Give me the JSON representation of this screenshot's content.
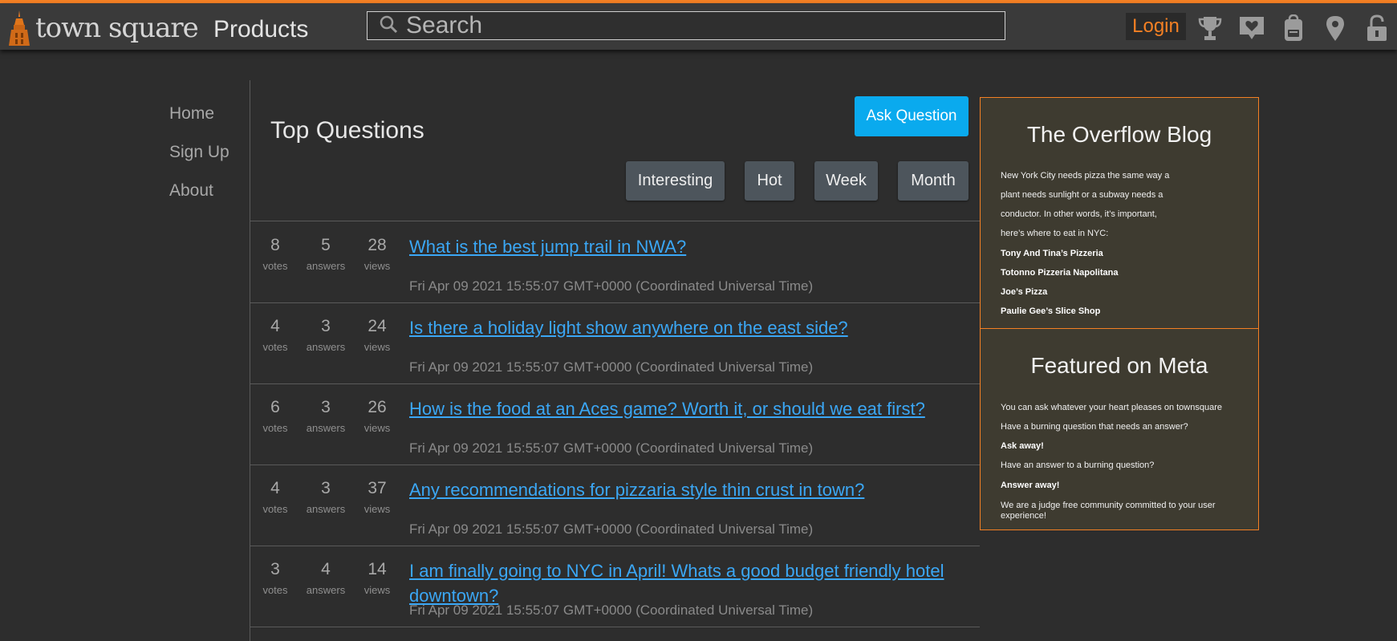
{
  "header": {
    "logo_text_1": "town",
    "logo_text_2": "square",
    "products_label": "Products",
    "search_placeholder": "Search",
    "login_label": "Login",
    "icons": [
      "trophy-icon",
      "heart-tag-icon",
      "backpack-icon",
      "location-pin-icon",
      "unlock-icon"
    ],
    "accent_color": "#f48024"
  },
  "sidebar": {
    "items": [
      {
        "label": "Home"
      },
      {
        "label": "Sign Up"
      },
      {
        "label": "About"
      }
    ]
  },
  "main": {
    "title": "Top Questions",
    "ask_button": "Ask Question",
    "filters": [
      "Interesting",
      "Hot",
      "Week",
      "Month"
    ],
    "stat_labels": {
      "votes": "votes",
      "answers": "answers",
      "views": "views"
    },
    "questions": [
      {
        "votes": "8",
        "answers": "5",
        "views": "28",
        "title": "What is the best jump trail in NWA?",
        "date": "Fri Apr 09 2021 15:55:07 GMT+0000 (Coordinated Universal Time)"
      },
      {
        "votes": "4",
        "answers": "3",
        "views": "24",
        "title": "Is there a holiday light show anywhere on the east side?",
        "date": "Fri Apr 09 2021 15:55:07 GMT+0000 (Coordinated Universal Time)"
      },
      {
        "votes": "6",
        "answers": "3",
        "views": "26",
        "title": "How is the food at an Aces game? Worth it, or should we eat first?",
        "date": "Fri Apr 09 2021 15:55:07 GMT+0000 (Coordinated Universal Time)"
      },
      {
        "votes": "4",
        "answers": "3",
        "views": "37",
        "title": "Any recommendations for pizzaria style thin crust in town?",
        "date": "Fri Apr 09 2021 15:55:07 GMT+0000 (Coordinated Universal Time)"
      },
      {
        "votes": "3",
        "answers": "4",
        "views": "14",
        "title": "I am finally going to NYC in April! Whats a good budget friendly hotel downtown?",
        "date": "Fri Apr 09 2021 15:55:07 GMT+0000 (Coordinated Universal Time)"
      }
    ]
  },
  "blog": {
    "title": "The Overflow Blog",
    "lines": [
      {
        "text": "New York City needs pizza the same way a",
        "bold": false
      },
      {
        "text": "plant needs sunlight or a subway needs a",
        "bold": false
      },
      {
        "text": "conductor. In other words, it’s important,",
        "bold": false
      },
      {
        "text": "here’s where to eat in NYC:",
        "bold": false
      },
      {
        "text": "Tony And Tina’s Pizzeria",
        "bold": true
      },
      {
        "text": "Totonno Pizzeria Napolitana",
        "bold": true
      },
      {
        "text": "Joe’s Pizza",
        "bold": true
      },
      {
        "text": "Paulie Gee’s Slice Shop",
        "bold": true
      }
    ]
  },
  "meta": {
    "title": "Featured on Meta",
    "lines": [
      {
        "text": "You can ask whatever your heart pleases on townsquare",
        "bold": false
      },
      {
        "text": "Have a burning question that needs an answer?",
        "bold": false
      },
      {
        "text": "Ask away!",
        "bold": true
      },
      {
        "text": "Have an answer to a burning question?",
        "bold": false
      },
      {
        "text": "Answer away!",
        "bold": true
      },
      {
        "text": "We are a judge free community committed to your user",
        "bold": false
      },
      {
        "text": "experience!",
        "bold": false
      }
    ]
  }
}
